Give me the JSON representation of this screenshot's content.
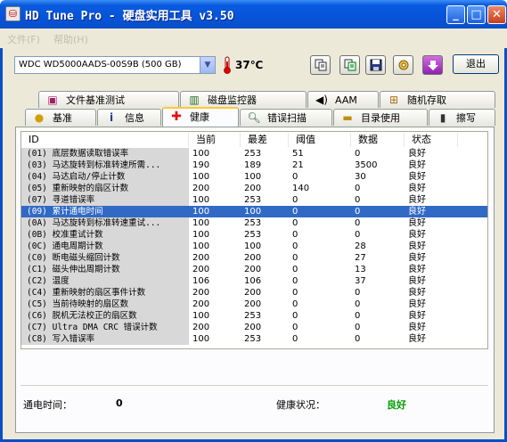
{
  "window": {
    "title": "HD Tune Pro - 硬盘实用工具 v3.50",
    "controls": [
      "_",
      "□",
      "✕"
    ]
  },
  "menu": [
    "文件(F)",
    "帮助(H)"
  ],
  "toolbar": {
    "drive": "WDC WD5000AADS-00S9B (500 GB)",
    "temperature": "37℃",
    "exit_label": "退出"
  },
  "tabs_top": [
    {
      "label": "文件基准测试",
      "icon": "file-benchmark-icon"
    },
    {
      "label": "磁盘监控器",
      "icon": "disk-monitor-icon"
    },
    {
      "label": "AAM",
      "icon": "speaker-icon"
    },
    {
      "label": "随机存取",
      "icon": "random-access-icon"
    }
  ],
  "tabs_bottom": [
    {
      "label": "基准",
      "icon": "benchmark-icon"
    },
    {
      "label": "信息",
      "icon": "info-icon"
    },
    {
      "label": "健康",
      "icon": "health-cross-icon"
    },
    {
      "label": "错误扫描",
      "icon": "magnifier-icon"
    },
    {
      "label": "目录使用",
      "icon": "folder-icon"
    },
    {
      "label": "擦写",
      "icon": "trash-icon"
    }
  ],
  "active_tab": "健康",
  "table": {
    "columns": [
      "ID",
      "当前",
      "最差",
      "阈值",
      "数据",
      "状态"
    ],
    "rows": [
      [
        "(01) 底层数据读取错误率",
        "100",
        "253",
        "51",
        "0",
        "良好"
      ],
      [
        "(03) 马达旋转到标准转速所需...",
        "190",
        "189",
        "21",
        "3500",
        "良好"
      ],
      [
        "(04) 马达启动/停止计数",
        "100",
        "100",
        "0",
        "30",
        "良好"
      ],
      [
        "(05) 重新映射的扇区计数",
        "200",
        "200",
        "140",
        "0",
        "良好"
      ],
      [
        "(07) 寻道错误率",
        "100",
        "253",
        "0",
        "0",
        "良好"
      ],
      [
        "(09) 累计通电时间",
        "100",
        "100",
        "0",
        "0",
        "良好"
      ],
      [
        "(0A) 马达旋转到标准转速重试...",
        "100",
        "253",
        "0",
        "0",
        "良好"
      ],
      [
        "(0B) 校准重试计数",
        "100",
        "253",
        "0",
        "0",
        "良好"
      ],
      [
        "(0C) 通电周期计数",
        "100",
        "100",
        "0",
        "28",
        "良好"
      ],
      [
        "(C0) 断电磁头缩回计数",
        "200",
        "200",
        "0",
        "27",
        "良好"
      ],
      [
        "(C1) 磁头伸出周期计数",
        "200",
        "200",
        "0",
        "13",
        "良好"
      ],
      [
        "(C2) 温度",
        "106",
        "106",
        "0",
        "37",
        "良好"
      ],
      [
        "(C4) 重新映射的扇区事件计数",
        "200",
        "200",
        "0",
        "0",
        "良好"
      ],
      [
        "(C5) 当前待映射的扇区数",
        "200",
        "200",
        "0",
        "0",
        "良好"
      ],
      [
        "(C6) 脱机无法校正的扇区数",
        "100",
        "253",
        "0",
        "0",
        "良好"
      ],
      [
        "(C7) Ultra DMA CRC 错误计数",
        "200",
        "200",
        "0",
        "0",
        "良好"
      ],
      [
        "(C8) 写入错误率",
        "100",
        "253",
        "0",
        "0",
        "良好"
      ]
    ],
    "selected_index": 5
  },
  "footer": {
    "power_on_label": "通电时间：",
    "power_on_value": "0",
    "health_label": "健康状况：",
    "health_value": "良好",
    "health_color": "#00a000"
  }
}
